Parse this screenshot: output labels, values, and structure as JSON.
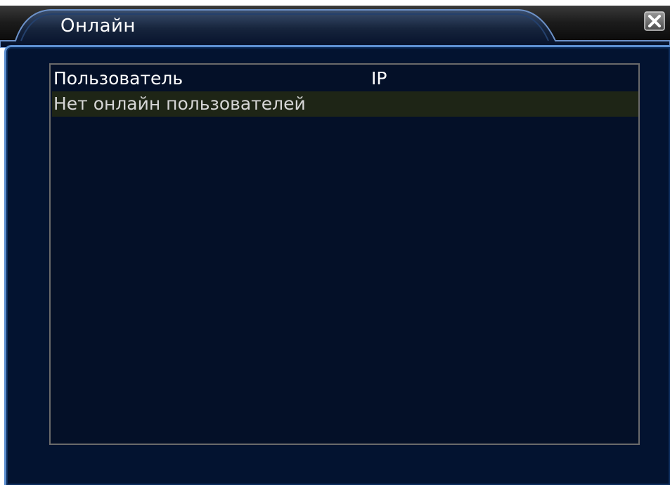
{
  "window": {
    "title": "Онлайн",
    "close_label": "×"
  },
  "table": {
    "columns": [
      "Пользователь",
      "IP"
    ],
    "empty_message": "Нет онлайн пользователей"
  },
  "colors": {
    "panel_background": "#031330",
    "panel_border": "#5c8fd0",
    "list_border": "#6a6a6a",
    "highlight_row": "#1e2516",
    "title_text": "#ffffff"
  }
}
